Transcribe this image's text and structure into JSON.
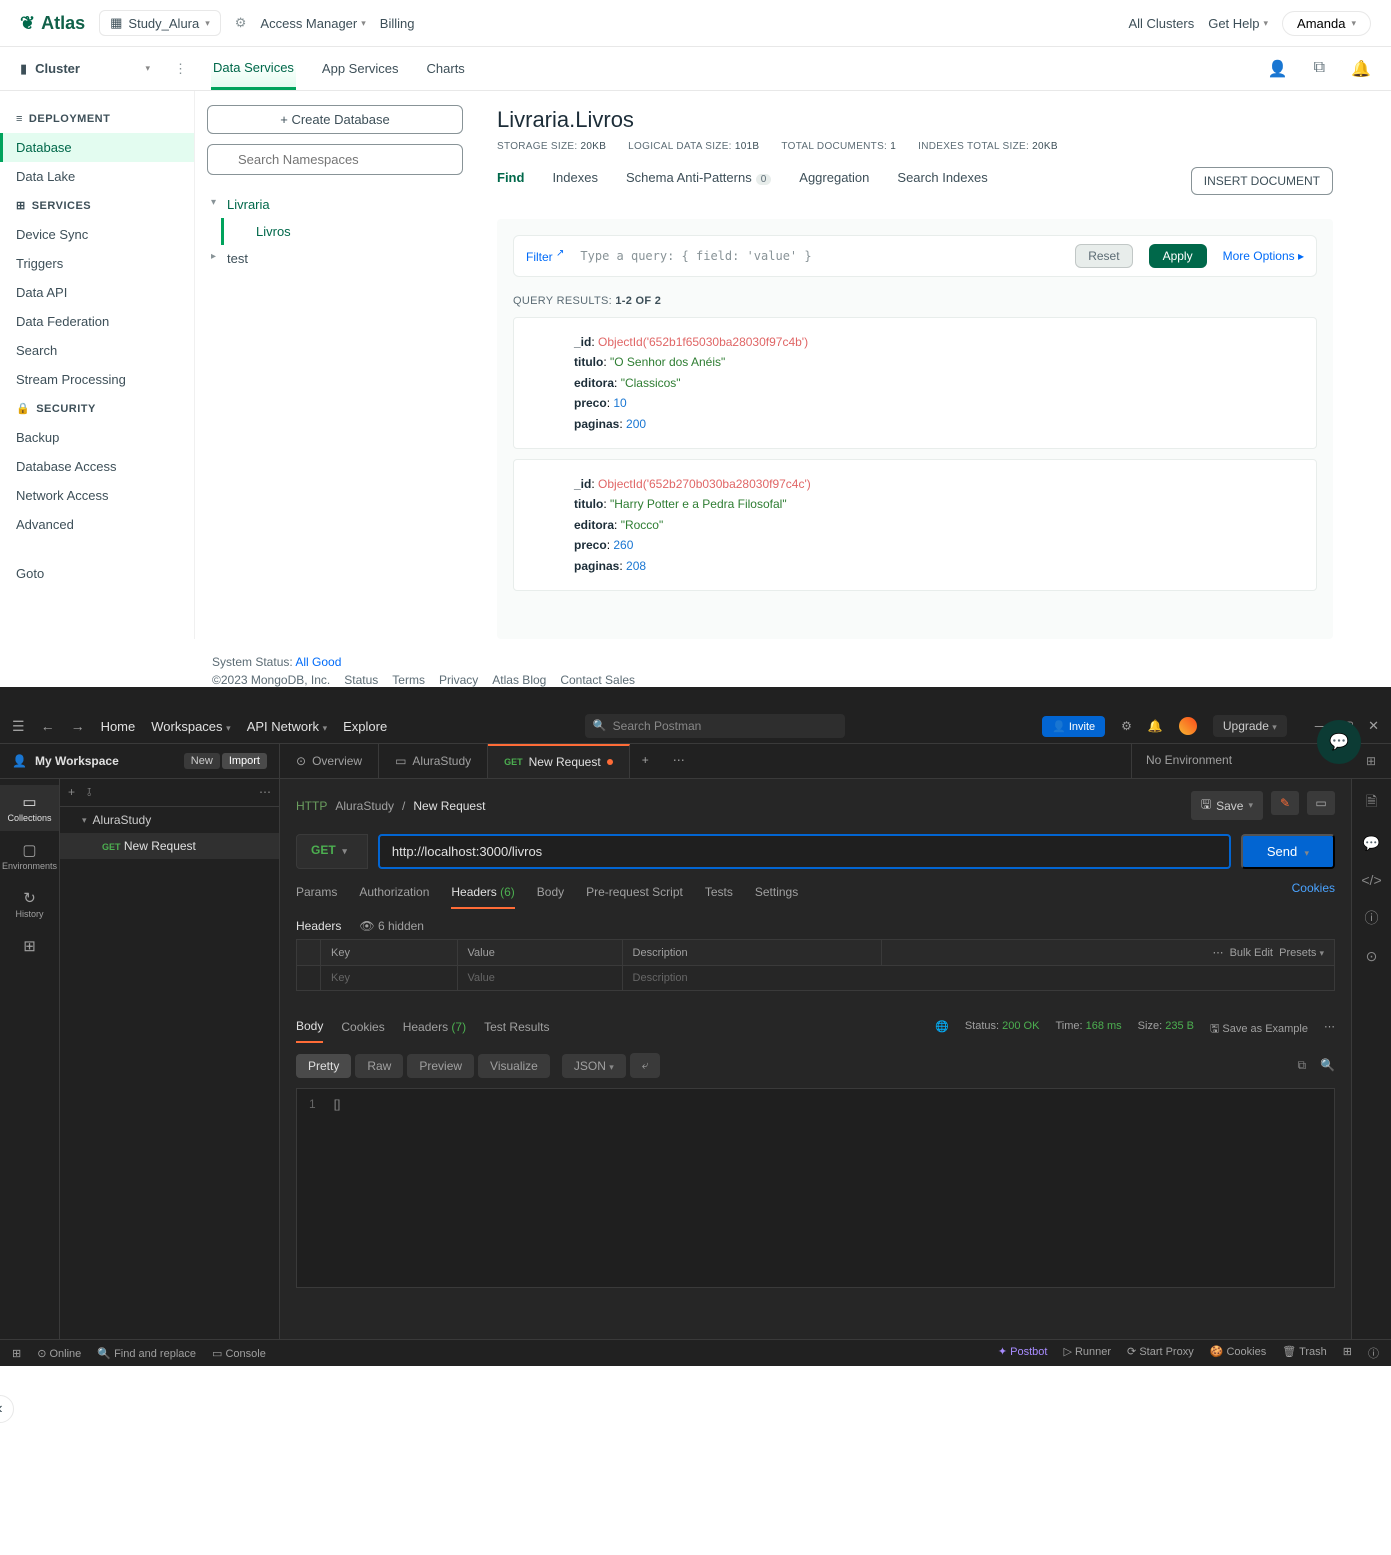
{
  "atlas": {
    "brand": "Atlas",
    "project": "Study_Alura",
    "header_links": {
      "access": "Access Manager",
      "billing": "Billing",
      "all_clusters": "All Clusters",
      "get_help": "Get Help",
      "user": "Amanda"
    },
    "cluster_label": "Cluster",
    "subtabs": {
      "data": "Data Services",
      "app": "App Services",
      "charts": "Charts"
    },
    "sidebar": {
      "deployment": "DEPLOYMENT",
      "database": "Database",
      "datalake": "Data Lake",
      "services": "SERVICES",
      "device_sync": "Device Sync",
      "triggers": "Triggers",
      "data_api": "Data API",
      "data_federation": "Data Federation",
      "search": "Search",
      "stream": "Stream Processing",
      "security": "SECURITY",
      "backup": "Backup",
      "db_access": "Database Access",
      "net_access": "Network Access",
      "advanced": "Advanced",
      "goto": "Goto"
    },
    "ns": {
      "create": "+ Create Database",
      "search_ph": "Search Namespaces",
      "db1": "Livraria",
      "coll1": "Livros",
      "db2": "test"
    },
    "collection": {
      "title": "Livraria.Livros",
      "stats": {
        "storage_l": "STORAGE SIZE:",
        "storage_v": "20KB",
        "logical_l": "LOGICAL DATA SIZE:",
        "logical_v": "101B",
        "total_l": "TOTAL DOCUMENTS:",
        "total_v": "1",
        "index_l": "INDEXES TOTAL SIZE:",
        "index_v": "20KB"
      },
      "tabs": {
        "find": "Find",
        "indexes": "Indexes",
        "schema": "Schema Anti-Patterns",
        "schema_badge": "0",
        "agg": "Aggregation",
        "searchidx": "Search Indexes"
      },
      "insert": "INSERT DOCUMENT",
      "filter": "Filter",
      "query_ph": "Type a query: { field: 'value' }",
      "reset": "Reset",
      "apply": "Apply",
      "more": "More Options ▸",
      "results_l": "QUERY RESULTS:",
      "results_v": "1-2 OF 2",
      "docs": [
        {
          "_id": "ObjectId('652b1f65030ba28030f97c4b')",
          "titulo": "\"O Senhor dos Anéis\"",
          "editora": "\"Classicos\"",
          "preco": "10",
          "paginas": "200"
        },
        {
          "_id": "ObjectId('652b270b030ba28030f97c4c')",
          "titulo": "\"Harry Potter e a Pedra Filosofal\"",
          "editora": "\"Rocco\"",
          "preco": "260",
          "paginas": "208"
        }
      ]
    },
    "status": {
      "label": "System Status:",
      "value": "All Good",
      "copyright": "©2023 MongoDB, Inc.",
      "links": [
        "Status",
        "Terms",
        "Privacy",
        "Atlas Blog",
        "Contact Sales"
      ]
    }
  },
  "pm": {
    "top": {
      "home": "Home",
      "workspaces": "Workspaces",
      "api_network": "API Network",
      "explore": "Explore",
      "search_ph": "Search Postman",
      "invite": "Invite",
      "upgrade": "Upgrade"
    },
    "ws": {
      "name": "My Workspace",
      "new": "New",
      "import": "Import"
    },
    "tabs": {
      "overview": "Overview",
      "alura": "AluraStudy",
      "newreq_method": "GET",
      "newreq": "New Request"
    },
    "env": "No Environment",
    "leftrail": {
      "collections": "Collections",
      "env": "Environments",
      "history": "History"
    },
    "sidebar": {
      "coll": "AluraStudy",
      "req_method": "GET",
      "req": "New Request"
    },
    "breadcrumb": {
      "ws": "AluraStudy",
      "cur": "New Request",
      "save": "Save"
    },
    "request": {
      "method": "GET",
      "url": "http://localhost:3000/livros",
      "send": "Send",
      "tabs": {
        "params": "Params",
        "auth": "Authorization",
        "headers": "Headers",
        "headers_cnt": "(6)",
        "body": "Body",
        "prereq": "Pre-request Script",
        "tests": "Tests",
        "settings": "Settings"
      },
      "cookies": "Cookies",
      "hdr_label": "Headers",
      "hidden": "6 hidden",
      "table": {
        "key": "Key",
        "value": "Value",
        "desc": "Description",
        "bulk": "Bulk Edit",
        "presets": "Presets"
      }
    },
    "response": {
      "tabs": {
        "body": "Body",
        "cookies": "Cookies",
        "headers": "Headers",
        "headers_cnt": "(7)",
        "tests": "Test Results"
      },
      "status_l": "Status:",
      "status_v": "200 OK",
      "time_l": "Time:",
      "time_v": "168 ms",
      "size_l": "Size:",
      "size_v": "235 B",
      "save_ex": "Save as Example",
      "views": {
        "pretty": "Pretty",
        "raw": "Raw",
        "preview": "Preview",
        "visualize": "Visualize",
        "json": "JSON"
      },
      "line1_num": "1",
      "line1": "[]"
    },
    "footer": {
      "online": "Online",
      "find": "Find and replace",
      "console": "Console",
      "postbot": "Postbot",
      "runner": "Runner",
      "proxy": "Start Proxy",
      "cookies": "Cookies",
      "trash": "Trash"
    }
  }
}
